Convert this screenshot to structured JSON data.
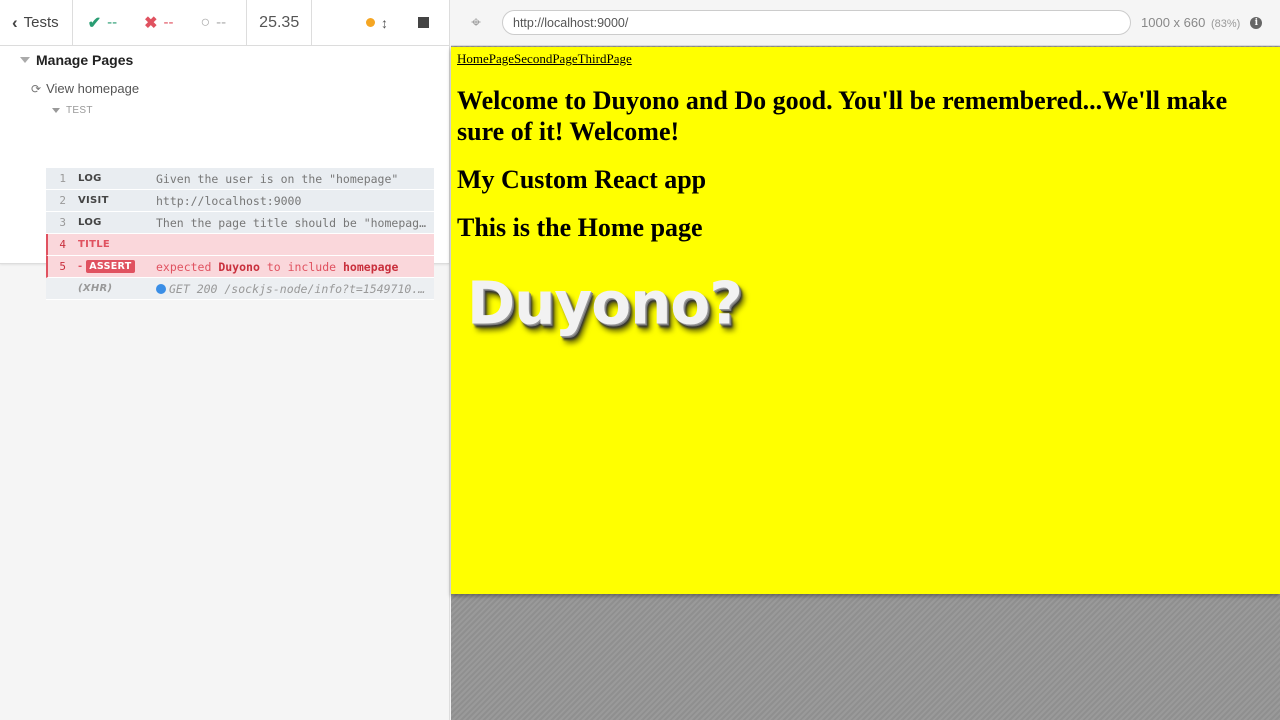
{
  "reporter": {
    "tests_label": "Tests",
    "passed_count": "--",
    "failed_count": "--",
    "pending_count": "--",
    "duration": "25.35"
  },
  "suite": {
    "title": "Manage Pages",
    "test_title": "View homepage",
    "hook_label": "TEST"
  },
  "commands": [
    {
      "num": "1",
      "name": "LOG",
      "message": "Given the user is on the \"homepage\""
    },
    {
      "num": "2",
      "name": "VISIT",
      "message": "http://localhost:9000"
    },
    {
      "num": "3",
      "name": "LOG",
      "message": "Then the page title should be \"homepage\""
    },
    {
      "num": "4",
      "name": "TITLE",
      "message": ""
    },
    {
      "num": "5",
      "name": "ASSERT",
      "prefix": "-",
      "msg_a": "expected",
      "msg_b": "Duyono",
      "msg_c": "to include",
      "msg_d": "homepage"
    },
    {
      "num": "",
      "name": "(XHR)",
      "message": "GET 200 /sockjs-node/info?t=1549710..."
    }
  ],
  "aut": {
    "url": "http://localhost:9000/",
    "viewport": "1000 x 660",
    "scale": "(83%)"
  },
  "app": {
    "nav": [
      "HomePage",
      "SecondPage",
      "ThirdPage"
    ],
    "heading": "Welcome to Duyono and Do good. You'll be remembered...We'll make sure of it! Welcome!",
    "subheading": "My Custom React app",
    "page_heading": "This is the Home page",
    "logo_text": "Duyono?"
  },
  "colors": {
    "app_background": "#ffff00",
    "passed": "#2a9d73",
    "failed": "#e05260",
    "running_dot": "#f5a623",
    "xhr_dot": "#3a8ee6"
  },
  "icons": [
    "chevron-left-icon",
    "check-icon",
    "x-icon",
    "spinner-icon",
    "resize-icon",
    "stop-icon",
    "refresh-icon",
    "crosshair-icon",
    "info-icon"
  ]
}
